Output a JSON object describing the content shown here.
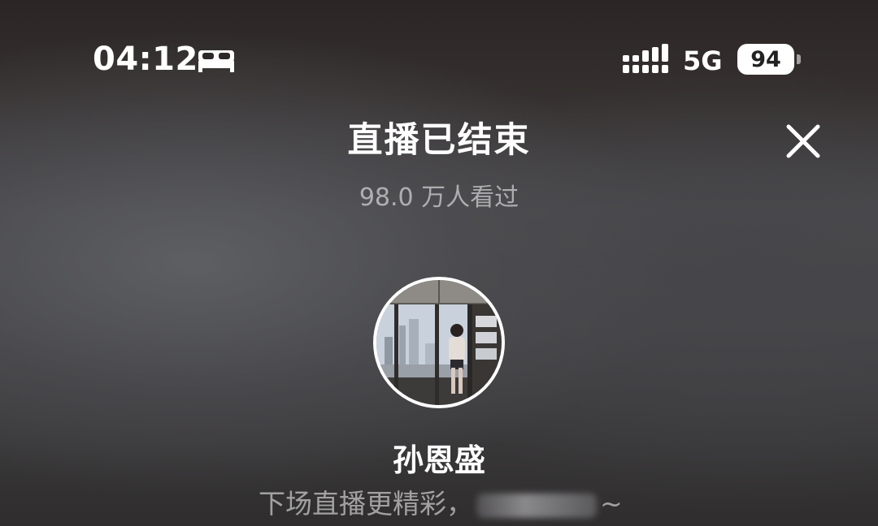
{
  "status_bar": {
    "time": "04:12",
    "focus_icon": "bed-icon",
    "signal_icon": "signal-bars-icon",
    "network": "5G",
    "battery_level": "94"
  },
  "live_end": {
    "title": "直播已结束",
    "viewers": "98.0 万人看过",
    "close_icon": "close-icon"
  },
  "streamer": {
    "avatar": "avatar-photo",
    "name": "孙恩盛",
    "message_prefix": "下场直播更精彩，",
    "message_suffix": "~"
  },
  "colors": {
    "background_dark": "#2b2625",
    "background_mid": "#4a4a4d",
    "text_primary": "#ffffff",
    "text_secondary": "#9a9a9d"
  }
}
